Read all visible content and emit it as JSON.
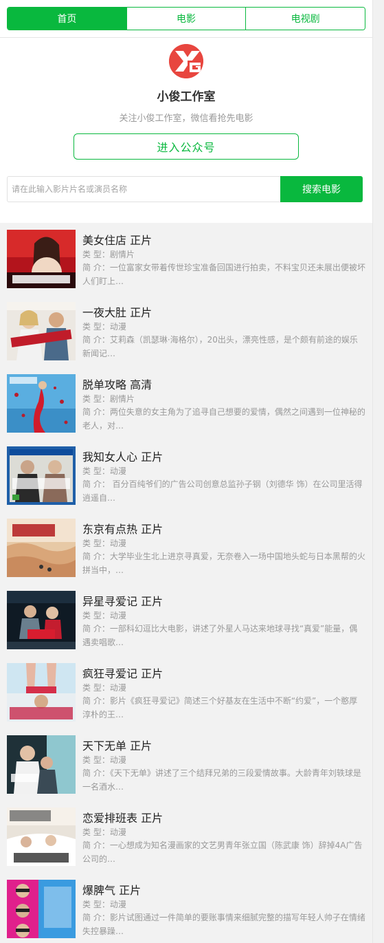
{
  "tabs": [
    {
      "label": "首页",
      "active": true
    },
    {
      "label": "电影",
      "active": false
    },
    {
      "label": "电视剧",
      "active": false
    }
  ],
  "header": {
    "logo_icon": "xg-logo-icon",
    "name": "小俊工作室",
    "subtitle": "关注小俊工作室，微信看抢先电影",
    "enter_button": "进入公众号"
  },
  "search": {
    "placeholder": "请在此输入影片片名或演员名称",
    "value": "",
    "button": "搜索电影"
  },
  "labels": {
    "genre": "类  型：",
    "intro": "简  介："
  },
  "colors": {
    "accent": "#09b83e",
    "logo": "#e8463f"
  },
  "movies": [
    {
      "title": "美女住店  正片",
      "genre": "剧情片",
      "intro": "一位富家女带着传世珍宝准备回国进行拍卖，不料宝贝还未展出便被坏人们盯上…",
      "poster_icon": "poster-image"
    },
    {
      "title": "一夜大肚  正片",
      "genre": "动漫",
      "intro": "艾莉森（凯瑟琳·海格尔），20出头，漂亮性感，是个颇有前途的娱乐新闻记…",
      "poster_icon": "poster-image"
    },
    {
      "title": "脱单攻略  高清",
      "genre": "剧情片",
      "intro": "两位失意的女主角为了追寻自己想要的爱情，偶然之间遇到一位神秘的老人，对…",
      "poster_icon": "poster-image"
    },
    {
      "title": "我知女人心  正片",
      "genre": "动漫",
      "intro": "   百分百纯爷们的广告公司创意总监孙子钢（刘德华 饰）在公司里活得逍遥自…",
      "poster_icon": "poster-image"
    },
    {
      "title": "东京有点热  正片",
      "genre": "动漫",
      "intro": "大学毕业生北上进京寻真爱，无奈卷入一场中国地头蛇与日本黑帮的火拼当中，…",
      "poster_icon": "poster-image"
    },
    {
      "title": "异星寻爱记  正片",
      "genre": "动漫",
      "intro": "一部科幻逗比大电影，讲述了外星人马达来地球寻找“真爱”能量，偶遇卖唱歌…",
      "poster_icon": "poster-image"
    },
    {
      "title": "疯狂寻爱记  正片",
      "genre": "动漫",
      "intro": "影片《疯狂寻爱记》简述三个好基友在生活中不断“约爱”，一个憨厚淳朴的王…",
      "poster_icon": "poster-image"
    },
    {
      "title": "天下无单  正片",
      "genre": "动漫",
      "intro": "《天下无单》讲述了三个结拜兄弟的三段爱情故事。大龄青年刘轶球是一名酒水…",
      "poster_icon": "poster-image"
    },
    {
      "title": "恋爱排班表  正片",
      "genre": "动漫",
      "intro": "一心想成为知名漫画家的文艺男青年张立国（陈武康 饰）辞掉4A广告公司的…",
      "poster_icon": "poster-image"
    },
    {
      "title": "爆脾气  正片",
      "genre": "动漫",
      "intro": "影片试图通过一件简单的要账事情来细腻完整的描写年轻人帅子在情绪失控暴躁…",
      "poster_icon": "poster-image"
    }
  ]
}
